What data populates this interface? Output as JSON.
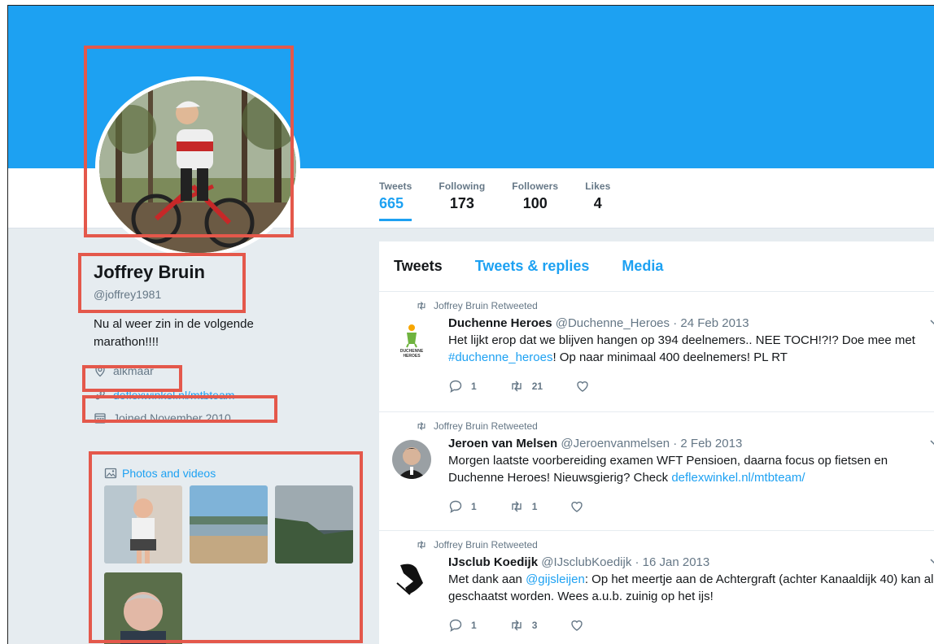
{
  "colors": {
    "brand": "#1da1f2",
    "highlight": "#e4584b"
  },
  "stats": [
    {
      "label": "Tweets",
      "value": "665",
      "active": true
    },
    {
      "label": "Following",
      "value": "173"
    },
    {
      "label": "Followers",
      "value": "100"
    },
    {
      "label": "Likes",
      "value": "4"
    }
  ],
  "profile": {
    "name": "Joffrey Bruin",
    "handle": "@joffrey1981",
    "bio": "Nu al weer zin in de volgende marathon!!!!",
    "location": "alkmaar",
    "url": "deflexwinkel.nl/mtbteam",
    "joined": "Joined November 2010"
  },
  "photos": {
    "title": "Photos and videos"
  },
  "timeline_tabs": [
    "Tweets",
    "Tweets & replies",
    "Media"
  ],
  "tweets": [
    {
      "retweet_label": "Joffrey Bruin Retweeted",
      "name": "Duchenne Heroes",
      "handle": "@Duchenne_Heroes",
      "date": "24 Feb 2013",
      "text_a": "Het lijkt erop dat we blijven hangen op 394 deelnemers.. NEE TOCH!?!? Doe mee met ",
      "link": "#duchenne_heroes",
      "text_b": "! Op naar minimaal 400 deelnemers! PL RT",
      "replies": "1",
      "retweets": "21",
      "avatar_logo": "DUCHENNE HEROES"
    },
    {
      "retweet_label": "Joffrey Bruin Retweeted",
      "name": "Jeroen van Melsen",
      "handle": "@Jeroenvanmelsen",
      "date": "2 Feb 2013",
      "text_a": "Morgen laatste voorbereiding examen WFT Pensioen, daarna focus op fietsen en Duchenne Heroes! Nieuwsgierig? Check ",
      "link": "deflexwinkel.nl/mtbteam/",
      "text_b": "",
      "replies": "1",
      "retweets": "1"
    },
    {
      "retweet_label": "Joffrey Bruin Retweeted",
      "name": "IJsclub Koedijk",
      "handle": "@IJsclubKoedijk",
      "date": "16 Jan 2013",
      "text_a": "Met dank aan ",
      "link": "@gijsleijen",
      "text_b": ": Op het meertje aan de Achtergraft (achter Kanaaldijk 40) kan al geschaatst worden. Wees a.u.b. zuinig op het ijs!",
      "replies": "1",
      "retweets": "3"
    }
  ]
}
